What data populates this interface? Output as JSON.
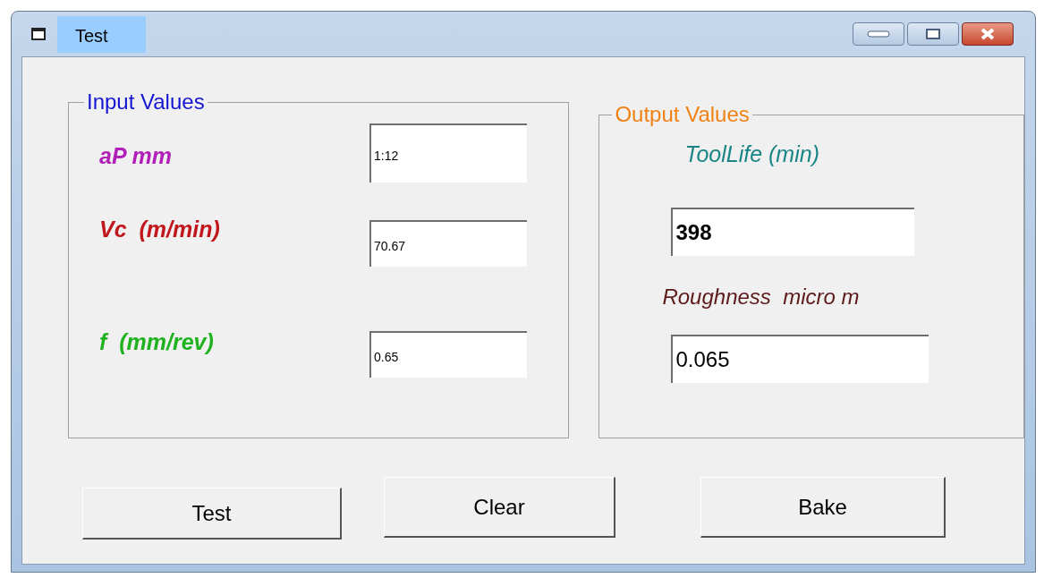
{
  "window": {
    "title": "Test"
  },
  "input_group": {
    "title": "Input Values",
    "fields": [
      {
        "label": "aP mm",
        "value": "1:12",
        "color": "#b21fb8"
      },
      {
        "label": "Vc  (m/min)",
        "value": "70.67",
        "color": "#c0161c"
      },
      {
        "label": "f  (mm/rev)",
        "value": "0.65",
        "color": "#1fb21f"
      }
    ]
  },
  "output_group": {
    "title": "Output Values",
    "fields": [
      {
        "label": "ToolLife (min)",
        "value": "398",
        "color": "#1a8585"
      },
      {
        "label": "Roughness  micro m",
        "value": "0.065",
        "color": "#5c1a1a"
      }
    ]
  },
  "buttons": [
    "Test",
    "Clear",
    "Bake"
  ]
}
